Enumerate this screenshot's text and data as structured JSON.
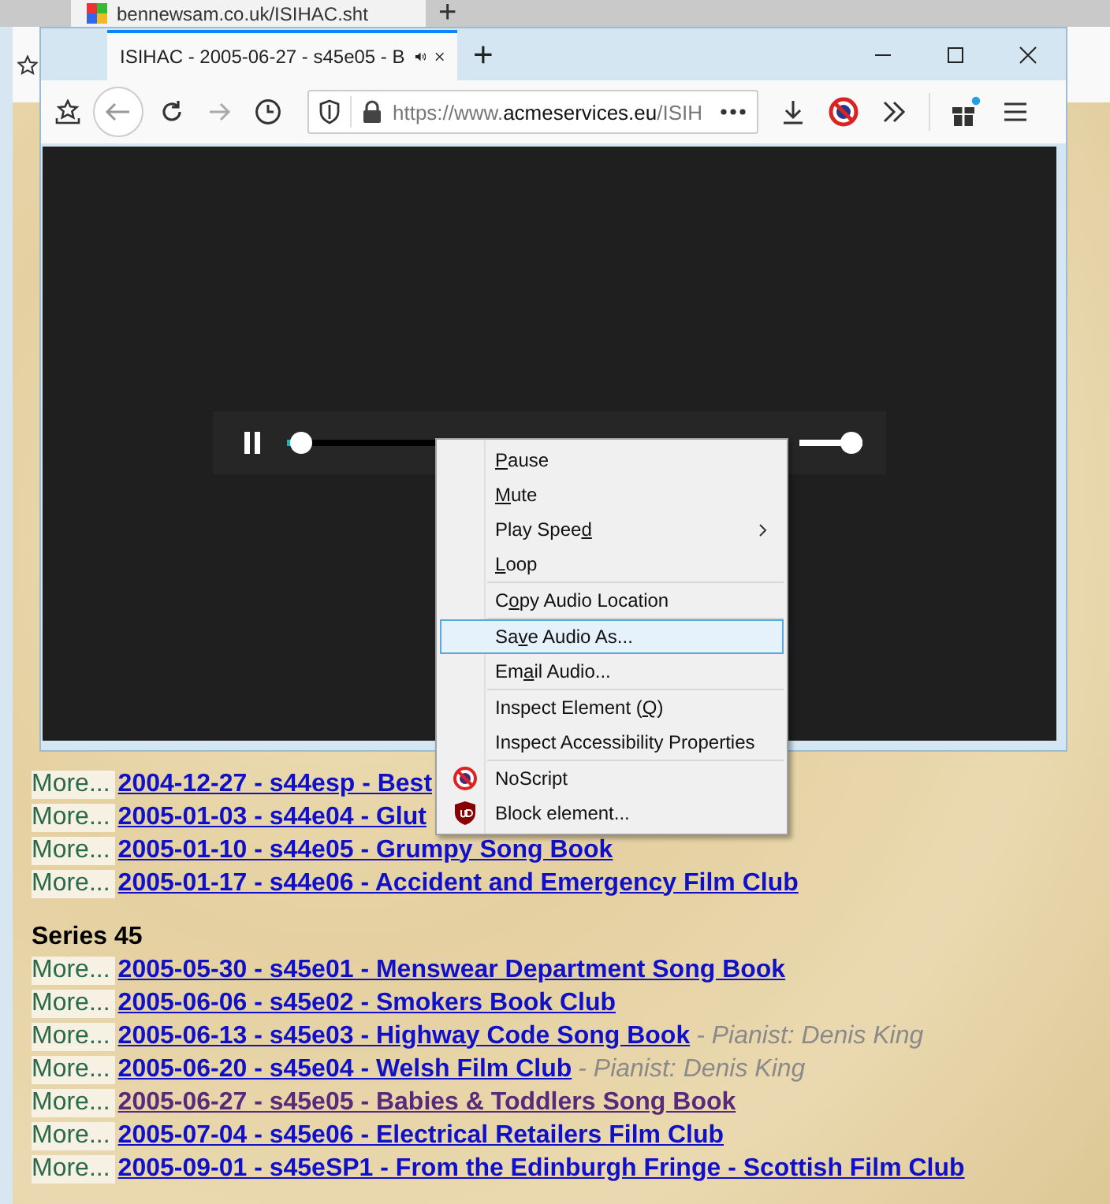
{
  "back_window": {
    "tab": {
      "title": "bennewsam.co.uk/ISIHAC.sht"
    },
    "new_tab": "+"
  },
  "page": {
    "rows": [
      {
        "more": "More...",
        "link": "2004-12-27 - s44esp - Best",
        "visited": false
      },
      {
        "more": "More...",
        "link": "2005-01-03 - s44e04 - Glut",
        "visited": false
      },
      {
        "more": "More...",
        "link": "2005-01-10 - s44e05 - Grumpy Song Book",
        "visited": false
      },
      {
        "more": "More...",
        "link": "2005-01-17 - s44e06 - Accident and Emergency Film Club",
        "visited": false
      }
    ],
    "sections": [
      {
        "heading": "Series 45",
        "rows": [
          {
            "more": "More...",
            "link": "2005-05-30 - s45e01 - Menswear Department Song Book",
            "visited": false
          },
          {
            "more": "More...",
            "link": "2005-06-06 - s45e02 - Smokers Book Club",
            "visited": false
          },
          {
            "more": "More...",
            "link": "2005-06-13 - s45e03 - Highway Code Song Book",
            "visited": false,
            "note": "- Pianist: Denis King"
          },
          {
            "more": "More...",
            "link": "2005-06-20 - s45e04 - Welsh Film Club",
            "visited": false,
            "note": "- Pianist: Denis King"
          },
          {
            "more": "More...",
            "link": "2005-06-27 - s45e05 - Babies & Toddlers Song Book",
            "visited": true
          },
          {
            "more": "More...",
            "link": "2005-07-04 - s45e06 - Electrical Retailers Film Club",
            "visited": false
          },
          {
            "more": "More...",
            "link": "2005-09-01 - s45eSP1 - From the Edinburgh Fringe - Scottish Film Club",
            "visited": false
          }
        ]
      }
    ]
  },
  "window": {
    "tab": {
      "title": "ISIHAC - 2005-06-27 - s45e05 - B",
      "playing": true
    },
    "new_tab": "+",
    "url": {
      "prefix": "https://www.",
      "domain": "acmeservices.eu",
      "path": "/ISIH"
    },
    "player": {
      "playing": true,
      "progress": {
        "level": 0.01
      },
      "volume": {
        "level": 1
      }
    }
  },
  "context_menu": {
    "groups": [
      [
        {
          "kind": "plain",
          "key": "P",
          "post": "ause",
          "submenu": false,
          "selected": false
        },
        {
          "kind": "plain",
          "key": "M",
          "post": "ute",
          "submenu": false,
          "selected": false
        },
        {
          "kind": "plain",
          "pre": "Play Spee",
          "key": "d",
          "submenu": true,
          "selected": false
        },
        {
          "kind": "plain",
          "key": "L",
          "post": "oop",
          "submenu": false,
          "selected": false
        }
      ],
      [
        {
          "kind": "plain",
          "pre": "C",
          "key": "o",
          "post": "py Audio Location",
          "submenu": false,
          "selected": false
        }
      ],
      [
        {
          "kind": "plain",
          "pre": "Sa",
          "key": "v",
          "post": "e Audio As...",
          "submenu": false,
          "selected": true
        },
        {
          "kind": "plain",
          "pre": "Em",
          "key": "a",
          "post": "il Audio...",
          "submenu": false,
          "selected": false
        }
      ],
      [
        {
          "kind": "plain",
          "pre": "Inspect Element (",
          "key": "Q",
          "post": ")",
          "submenu": false,
          "selected": false
        },
        {
          "kind": "plain",
          "pre": "Inspect Accessibility Properties",
          "submenu": false,
          "selected": false
        }
      ],
      [
        {
          "kind": "noscript",
          "pre": "NoScript",
          "submenu": false,
          "selected": false
        },
        {
          "kind": "blocker",
          "pre": "Block element...",
          "submenu": false,
          "selected": false
        }
      ]
    ]
  }
}
